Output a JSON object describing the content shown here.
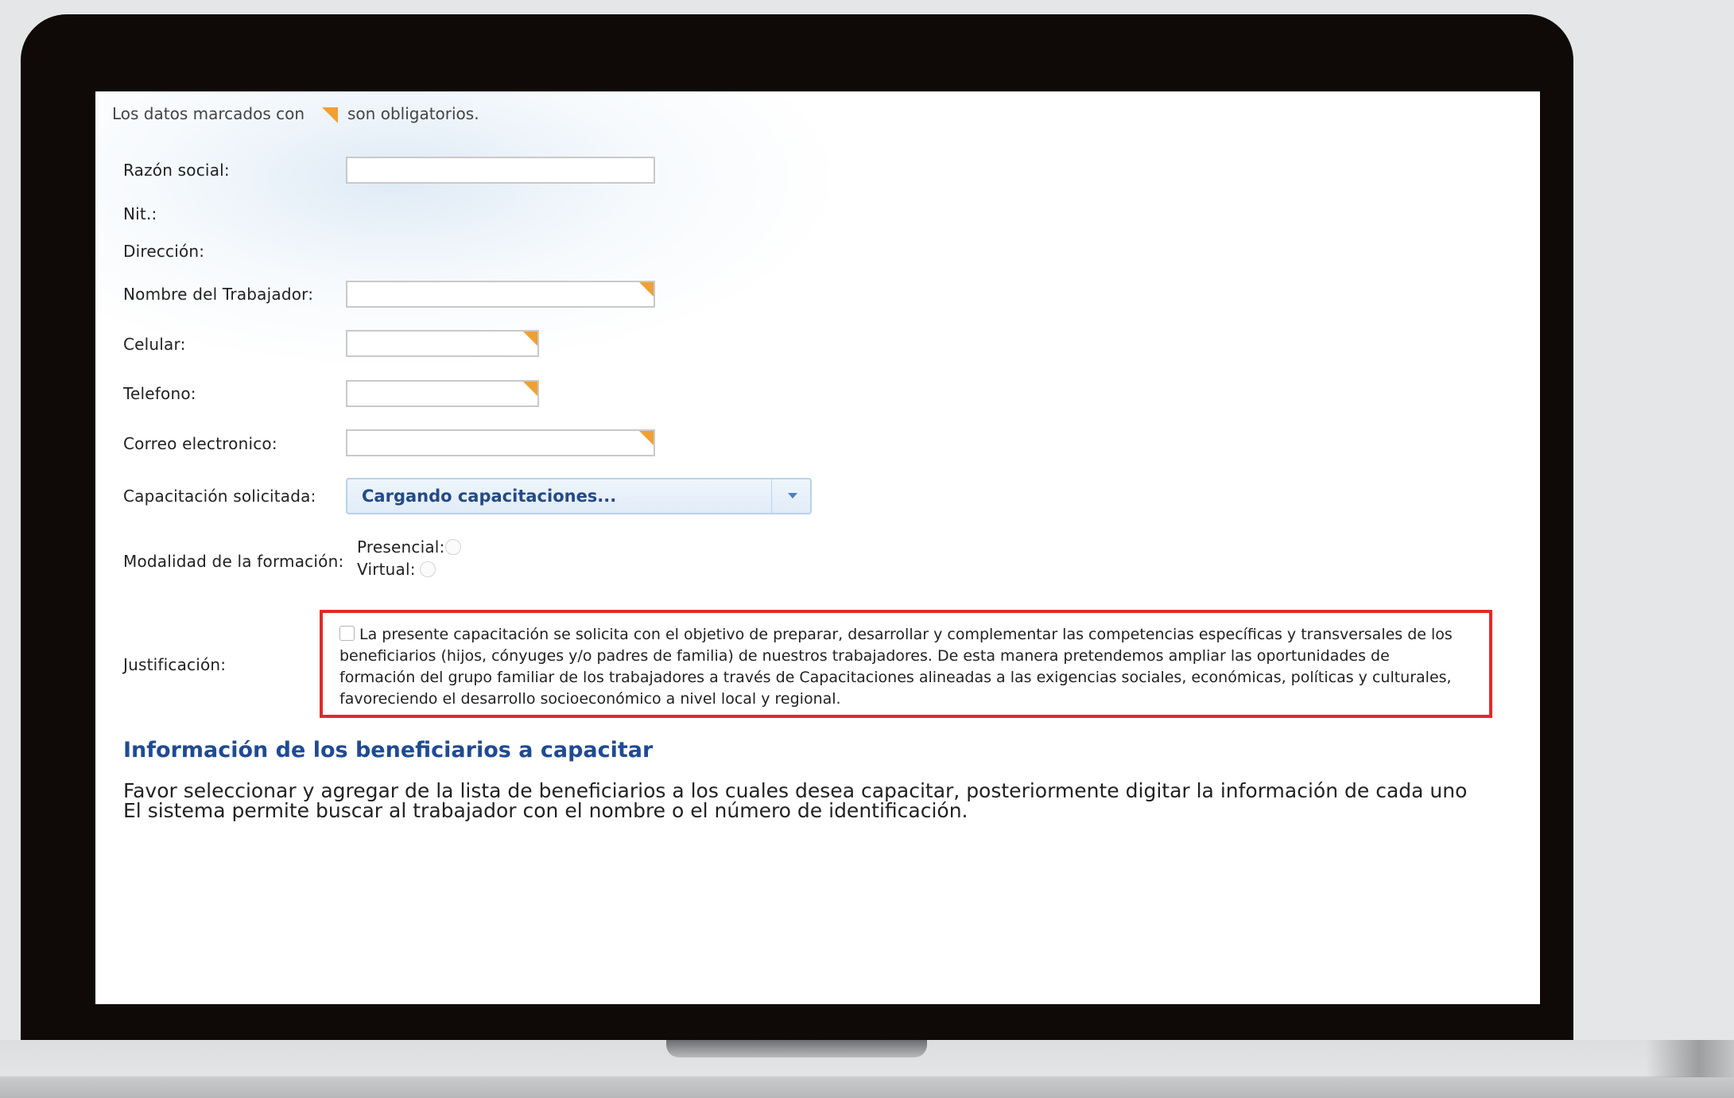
{
  "form": {
    "required_note_prefix": "Los datos marcados con",
    "required_note_suffix": "son obligatorios.",
    "labels": {
      "razon_social": "Razón social:",
      "nit": "Nit.:",
      "direccion": "Dirección:",
      "nombre_trabajador": "Nombre del Trabajador:",
      "celular": "Celular:",
      "telefono": "Telefono:",
      "correo": "Correo electronico:",
      "capacitacion": "Capacitación solicitada:",
      "modalidad": "Modalidad de la formación:",
      "justificacion": "Justificación:"
    },
    "values": {
      "razon_social": "",
      "nombre_trabajador": "",
      "celular": "",
      "telefono": "",
      "correo": ""
    },
    "capacitacion_select": "Cargando capacitaciones...",
    "modalidad_options": {
      "presencial": "Presencial:",
      "virtual": "Virtual:"
    },
    "justificacion_text": "La presente capacitación se solicita con el objetivo de preparar, desarrollar y complementar las competencias específicas y transversales de los beneficiarios (hijos, cónyuges y/o padres de familia) de nuestros trabajadores. De esta manera pretendemos ampliar las oportunidades de formación del grupo familiar de los trabajadores a través de Capacitaciones alineadas a las exigencias sociales, económicas, políticas y culturales, favoreciendo el desarrollo socioeconómico a nivel local y regional.",
    "justificacion_checked": false
  },
  "beneficiarios": {
    "title": "Información de los beneficiarios a capacitar",
    "line1": "Favor seleccionar y agregar de la lista de beneficiarios a los cuales desea capacitar, posteriormente digitar la información de cada uno",
    "line2": "El sistema permite buscar al trabajador con el nombre o el número de identificación."
  },
  "colors": {
    "required_flag": "#f0a033",
    "section_title": "#1f4b94",
    "highlight_border": "#e3292b"
  }
}
